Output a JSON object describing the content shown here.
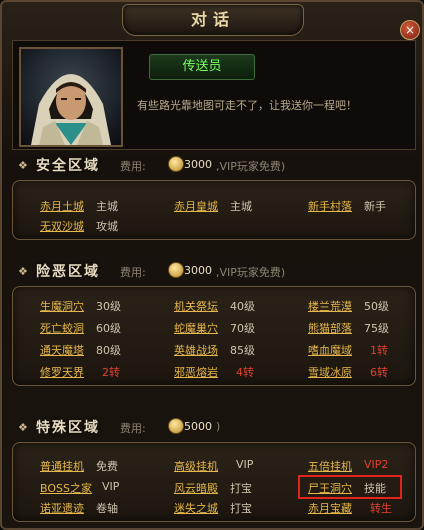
{
  "window": {
    "title": "对话",
    "close_glyph": "×"
  },
  "npc": {
    "name": "传送员",
    "line": "有些路光靠地图可走不了，让我送你一程吧！"
  },
  "fee_label": "费用:",
  "sections": {
    "safe": {
      "title": "安全区域",
      "fee": "3000",
      "note": ",VIP玩家免费)",
      "rows": [
        [
          {
            "name": "赤月土城",
            "tag": "主城"
          },
          {
            "name": "赤月皇城",
            "tag": "主城"
          },
          {
            "name": "新手村落",
            "tag": "新手"
          }
        ],
        [
          {
            "name": "无双沙城",
            "tag": "攻城"
          }
        ]
      ]
    },
    "danger": {
      "title": "险恶区域",
      "fee": "3000",
      "note": ",VIP玩家免费)",
      "rows": [
        [
          {
            "name": "生魔洞穴",
            "tag": "30级"
          },
          {
            "name": "机关祭坛",
            "tag": "40级"
          },
          {
            "name": "楼兰荒漠",
            "tag": "50级"
          }
        ],
        [
          {
            "name": "死亡蛟洞",
            "tag": "60级"
          },
          {
            "name": "蛇魔巢穴",
            "tag": "70级"
          },
          {
            "name": "熊猫部落",
            "tag": "75级"
          }
        ],
        [
          {
            "name": "通天魔塔",
            "tag": "80级"
          },
          {
            "name": "英雄战场",
            "tag": "85级"
          },
          {
            "name": "嗜血魔域",
            "tag": "1转"
          }
        ],
        [
          {
            "name": "修罗天界",
            "tag": "2转"
          },
          {
            "name": "邪恶熔岩",
            "tag": "4转"
          },
          {
            "name": "雪域冰原",
            "tag": "6转"
          }
        ]
      ]
    },
    "special": {
      "title": "特殊区域",
      "fee": "5000",
      "note": ")",
      "rows": [
        [
          {
            "name": "普通挂机",
            "tag": "免费"
          },
          {
            "name": "高级挂机",
            "tag": "VIP"
          },
          {
            "name": "五倍挂机",
            "tag": "VIP2"
          }
        ],
        [
          {
            "name": "BOSS之家",
            "tag": "VIP"
          },
          {
            "name": "风云暗殿",
            "tag": "打宝"
          },
          {
            "name": "尸王洞穴",
            "tag": "技能"
          }
        ],
        [
          {
            "name": "诺亚遗迹",
            "tag": "卷轴"
          },
          {
            "name": "迷失之城",
            "tag": "打宝"
          },
          {
            "name": "赤月宝藏",
            "tag": "转生"
          }
        ]
      ]
    }
  },
  "colors": {
    "link": "#e6b74a",
    "red_tag": "#e2402e",
    "npc_name": "#7cff62",
    "highlight": "#e0231c"
  }
}
